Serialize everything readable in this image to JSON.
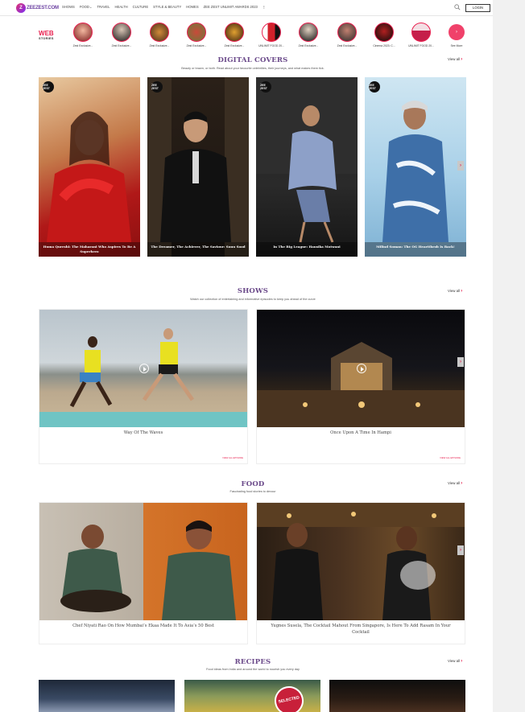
{
  "header": {
    "logo_text": "ZEEZEST.COM",
    "nav": [
      "SHOWS",
      "FOOD",
      "TRAVEL",
      "HEALTH",
      "CULTURE",
      "STYLE & BEAUTY",
      "HOMES",
      "ZEE ZEST UNLIMIT AWARDS 2023"
    ],
    "more": "⋮",
    "login_label": "LOGIN"
  },
  "web_stories": {
    "label_web": "WEB",
    "label_stories": "STORIES",
    "items": [
      "Zest Exclusive...",
      "Zest Exclusive...",
      "Zest Exclusive...",
      "Zest Exclusive...",
      "Zest Exclusive...",
      "UNLIMIT FOOD 20...",
      "Zest Exclusive...",
      "Zest Exclusive...",
      "Cinema 2023: C...",
      "UNLIMIT FOOD 20..."
    ],
    "see_more": "See More"
  },
  "digital_covers": {
    "title": "DIGITAL COVERS",
    "subtitle": "Beauty or brawn, or both. Read about your favourite celebrities, their journeys, and what makes them tick.",
    "view_all": "View all",
    "badge": "ZEE ZEST",
    "items": [
      "Huma Qureshi: The Maharani Who Aspires To Be A Superhero",
      "The Dreamer, The Achiever, The Saviour: Sonu Sood",
      "In The Big League: Hansika Motwani",
      "Milind Soman: The OG Heartthrob Is Back!"
    ]
  },
  "shows": {
    "title": "SHOWS",
    "subtitle": "Watch our collection of entertaining and informative episodes to keep you ahead of the curve",
    "view_all": "View all",
    "items": [
      {
        "title": "Way Of The Waves",
        "meta": "VIEW ALL EPISODE"
      },
      {
        "title": "Once Upon A Time In Hampi",
        "meta": "VIEW ALL EPISODE"
      }
    ]
  },
  "food": {
    "title": "FOOD",
    "subtitle": "Fascinating food stories to devour",
    "view_all": "View all",
    "items": [
      "Chef Niyati Rao On How Mumbai’s Ekaa Made It To Asia’s 50 Best",
      "Yugnes Susela, The Cocktail Mahout From Singapore, Is Here To Add Rasam In Your Cocktail"
    ]
  },
  "recipes": {
    "title": "RECIPES",
    "subtitle": "Food ideas from India and around the world to nourish you every day",
    "view_all": "View all",
    "stamp": "SELECTED"
  },
  "colors": {
    "accent": "#e8204f",
    "section_title": "#6b4a8a"
  }
}
